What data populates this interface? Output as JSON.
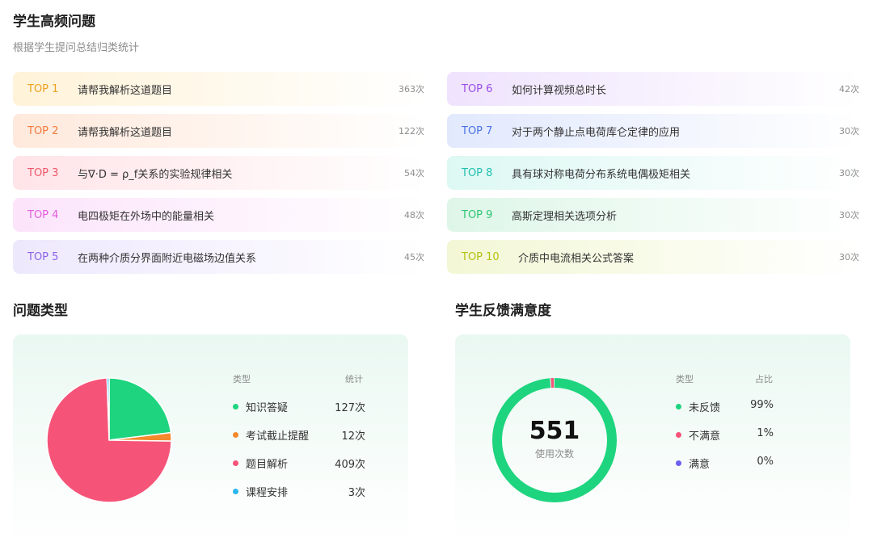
{
  "header": {
    "title": "学生高频问题",
    "subtitle": "根据学生提问总结归类统计"
  },
  "top_questions": [
    {
      "rank": "TOP 1",
      "text": "请帮我解析这道题目",
      "count": "363次",
      "color": "#f0a020",
      "bg": "#fff3d9"
    },
    {
      "rank": "TOP 2",
      "text": "请帮我解析这道题目",
      "count": "122次",
      "color": "#f07a3a",
      "bg": "#ffe9dc"
    },
    {
      "rank": "TOP 3",
      "text": "与∇·D = ρ_f关系的实验规律相关",
      "count": "54次",
      "color": "#f0566a",
      "bg": "#ffe4e8"
    },
    {
      "rank": "TOP 4",
      "text": "电四极矩在外场中的能量相关",
      "count": "48次",
      "color": "#e25ce0",
      "bg": "#fce4fb"
    },
    {
      "rank": "TOP 5",
      "text": "在两种介质分界面附近电磁场边值关系",
      "count": "45次",
      "color": "#8a63e8",
      "bg": "#eee8fd"
    },
    {
      "rank": "TOP 6",
      "text": "如何计算视频总时长",
      "count": "42次",
      "color": "#9a4de8",
      "bg": "#efe3fd"
    },
    {
      "rank": "TOP 7",
      "text": "对于两个静止点电荷库仑定律的应用",
      "count": "30次",
      "color": "#4a72e8",
      "bg": "#e2e9fd"
    },
    {
      "rank": "TOP 8",
      "text": "具有球对称电荷分布系统电偶极矩相关",
      "count": "30次",
      "color": "#22c0b0",
      "bg": "#ddf8f3"
    },
    {
      "rank": "TOP 9",
      "text": "高斯定理相关选项分析",
      "count": "30次",
      "color": "#2ec474",
      "bg": "#def6e8"
    },
    {
      "rank": "TOP 10",
      "text": "介质中电流相关公式答案",
      "count": "30次",
      "color": "#b5c010",
      "bg": "#f3f7d5"
    }
  ],
  "question_types": {
    "title": "问题类型",
    "col_type": "类型",
    "col_count": "统计",
    "items": [
      {
        "name": "知识答疑",
        "count": "127次",
        "value": 127,
        "color": "#1ed47e"
      },
      {
        "name": "考试截止提醒",
        "count": "12次",
        "value": 12,
        "color": "#f5892b"
      },
      {
        "name": "题目解析",
        "count": "409次",
        "value": 409,
        "color": "#f55478"
      },
      {
        "name": "课程安排",
        "count": "3次",
        "value": 3,
        "color": "#2ab6ee"
      }
    ]
  },
  "satisfaction": {
    "title": "学生反馈满意度",
    "center_value": "551",
    "center_label": "使用次数",
    "col_type": "类型",
    "col_ratio": "占比",
    "items": [
      {
        "name": "未反馈",
        "ratio": "99%",
        "value": 99,
        "color": "#1ed47e"
      },
      {
        "name": "不满意",
        "ratio": "1%",
        "value": 1,
        "color": "#f55478"
      },
      {
        "name": "满意",
        "ratio": "0%",
        "value": 0,
        "color": "#6c5ef0"
      }
    ]
  },
  "chart_data": [
    {
      "type": "pie",
      "categories": [
        "知识答疑",
        "考试截止提醒",
        "题目解析",
        "课程安排"
      ],
      "values": [
        127,
        12,
        409,
        3
      ],
      "colors": [
        "#1ed47e",
        "#f5892b",
        "#f55478",
        "#2ab6ee"
      ],
      "title": "问题类型"
    },
    {
      "type": "pie",
      "categories": [
        "未反馈",
        "不满意",
        "满意"
      ],
      "values": [
        99,
        1,
        0
      ],
      "colors": [
        "#1ed47e",
        "#f55478",
        "#6c5ef0"
      ],
      "title": "学生反馈满意度"
    }
  ]
}
